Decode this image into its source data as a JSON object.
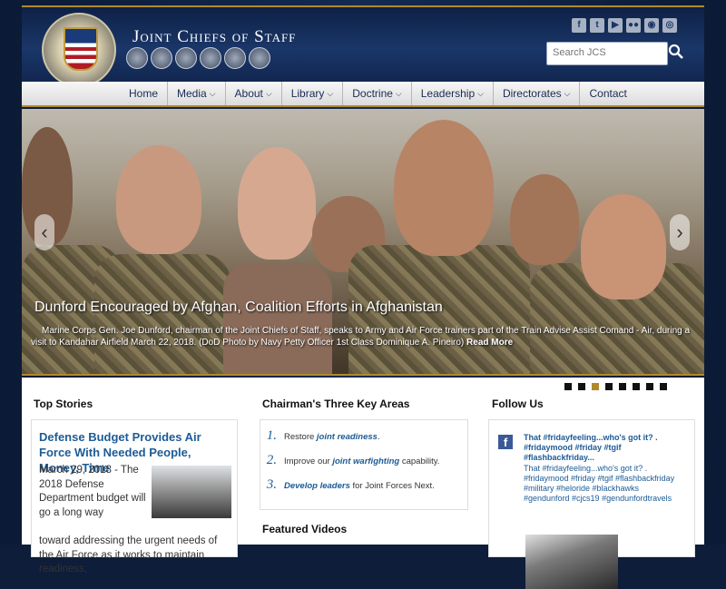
{
  "header": {
    "title": "Joint Chiefs of Staff",
    "search_placeholder": "Search JCS",
    "social": [
      "f",
      "t",
      "▶",
      "●●",
      "◉",
      "◎"
    ]
  },
  "nav": [
    {
      "label": "Home",
      "dropdown": false
    },
    {
      "label": "Media",
      "dropdown": true
    },
    {
      "label": "About",
      "dropdown": true
    },
    {
      "label": "Library",
      "dropdown": true
    },
    {
      "label": "Doctrine",
      "dropdown": true
    },
    {
      "label": "Leadership",
      "dropdown": true
    },
    {
      "label": "Directorates",
      "dropdown": true
    },
    {
      "label": "Contact",
      "dropdown": false
    }
  ],
  "hero": {
    "title": "Dunford Encouraged by Afghan, Coalition Efforts in Afghanistan",
    "caption": "Marine Corps Gen. Joe Dunford, chairman of the Joint Chiefs of Staff, speaks to Army and Air Force trainers part of the Train Advise Assist Comand - Air, during a visit to Kandahar Airfield March 22, 2018. (DoD Photo by Navy Petty Officer 1st Class Dominique A. Pineiro)",
    "read_more": "Read More",
    "prev": "‹",
    "next": "›",
    "slides": 8,
    "active_slide": 3
  },
  "top_stories": {
    "heading": "Top Stories",
    "story_title": "Defense Budget Provides Air Force With Needed People, Money, Time",
    "story_text_a": "March 29, 2018 - The 2018 Defense Department budget will go a long way",
    "story_text_b": "toward addressing the urgent needs of the Air Force as it works to maintain readiness,"
  },
  "key_areas": {
    "heading": "Chairman's Three Key Areas",
    "items": [
      {
        "num": "1.",
        "pre": "Restore ",
        "em": "joint readiness",
        "post": "."
      },
      {
        "num": "2.",
        "pre": "Improve our ",
        "em": "joint warfighting",
        "post": " capability."
      },
      {
        "num": "3.",
        "pre": "",
        "em": "Develop leaders",
        "post": " for Joint Forces Next."
      }
    ]
  },
  "featured_videos": {
    "heading": "Featured Videos"
  },
  "follow_us": {
    "heading": "Follow Us",
    "fb_head": "That #fridayfeeling...who's got it? . #fridaymood #friday #tgif #flashbackfriday...",
    "fb_text": "That #fridayfeeling...who's got it? . #fridaymood #friday #tgif #flashbackfriday #military #heloride #blackhawks #gendunford #cjcs19 #gendunfordtravels"
  },
  "colors": {
    "accent": "#b08a2a",
    "link": "#1c5b96",
    "navy": "#132a52"
  }
}
